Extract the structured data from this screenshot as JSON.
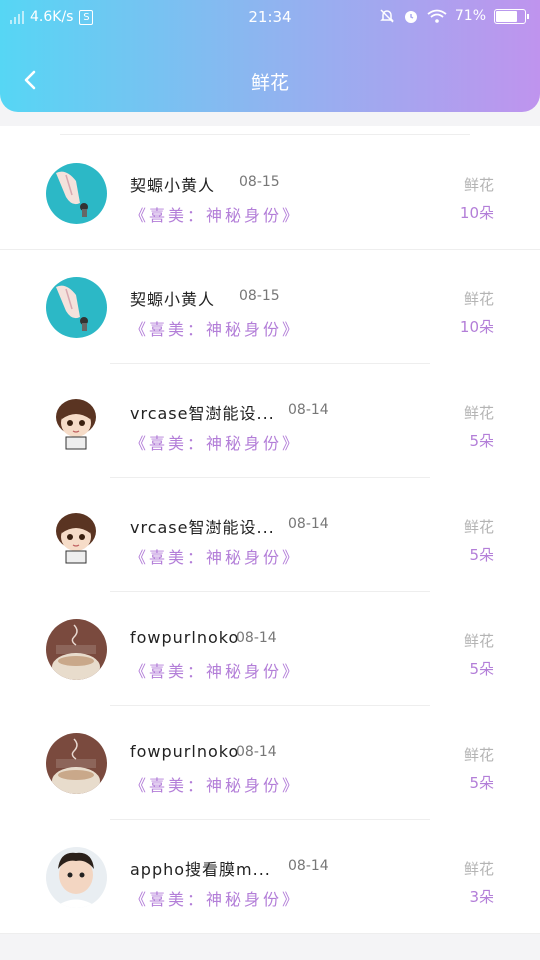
{
  "status_bar": {
    "speed": "4.6K/s",
    "s_icon": "S",
    "time": "21:34",
    "battery_pct": "71%"
  },
  "nav": {
    "title": "鲜花"
  },
  "records": [
    {
      "name": "契螈小黄人",
      "date": "08-15",
      "gift": "《喜美：神秘身份》",
      "label": "鲜花",
      "count": "10朵",
      "avatar": "hand-avatar"
    },
    {
      "name": "契螈小黄人",
      "date": "08-15",
      "gift": "《喜美：神秘身份》",
      "label": "鲜花",
      "count": "10朵",
      "avatar": "hand-avatar"
    },
    {
      "name": "vrcase智澍能设...",
      "date": "08-14",
      "gift": "《喜美：神秘身份》",
      "label": "鲜花",
      "count": "5朵",
      "avatar": "cartoon-boy-avatar"
    },
    {
      "name": "vrcase智澍能设...",
      "date": "08-14",
      "gift": "《喜美：神秘身份》",
      "label": "鲜花",
      "count": "5朵",
      "avatar": "cartoon-boy-avatar"
    },
    {
      "name": "fowpurlnoko",
      "date": "08-14",
      "gift": "《喜美：神秘身份》",
      "label": "鲜花",
      "count": "5朵",
      "avatar": "cup-avatar"
    },
    {
      "name": "fowpurlnoko",
      "date": "08-14",
      "gift": "《喜美：神秘身份》",
      "label": "鲜花",
      "count": "5朵",
      "avatar": "cup-avatar"
    },
    {
      "name": "appho搜看膜m...",
      "date": "08-14",
      "gift": "《喜美：神秘身份》",
      "label": "鲜花",
      "count": "3朵",
      "avatar": "child-photo-avatar"
    }
  ]
}
